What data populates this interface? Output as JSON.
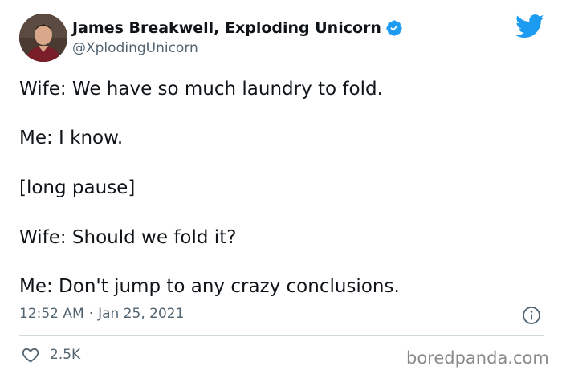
{
  "author": {
    "display_name": "James Breakwell, Exploding Unicorn",
    "handle": "@XplodingUnicorn",
    "verified": true
  },
  "tweet": {
    "lines": [
      "Wife: We have so much laundry to fold.",
      "Me: I know.",
      "[long pause]",
      "Wife: Should we fold it?",
      "Me: Don't jump to any crazy conclusions."
    ]
  },
  "meta": {
    "time": "12:52 AM",
    "separator": "·",
    "date": "Jan 25, 2021"
  },
  "engagement": {
    "likes": "2.5K"
  },
  "watermark": "boredpanda.com",
  "colors": {
    "twitter_blue": "#1d9bf0",
    "text_primary": "#0f1419",
    "text_secondary": "#536471",
    "divider": "#cfd9de"
  },
  "icons": [
    "avatar",
    "verified-badge-icon",
    "twitter-bird-icon",
    "info-icon",
    "heart-icon"
  ]
}
